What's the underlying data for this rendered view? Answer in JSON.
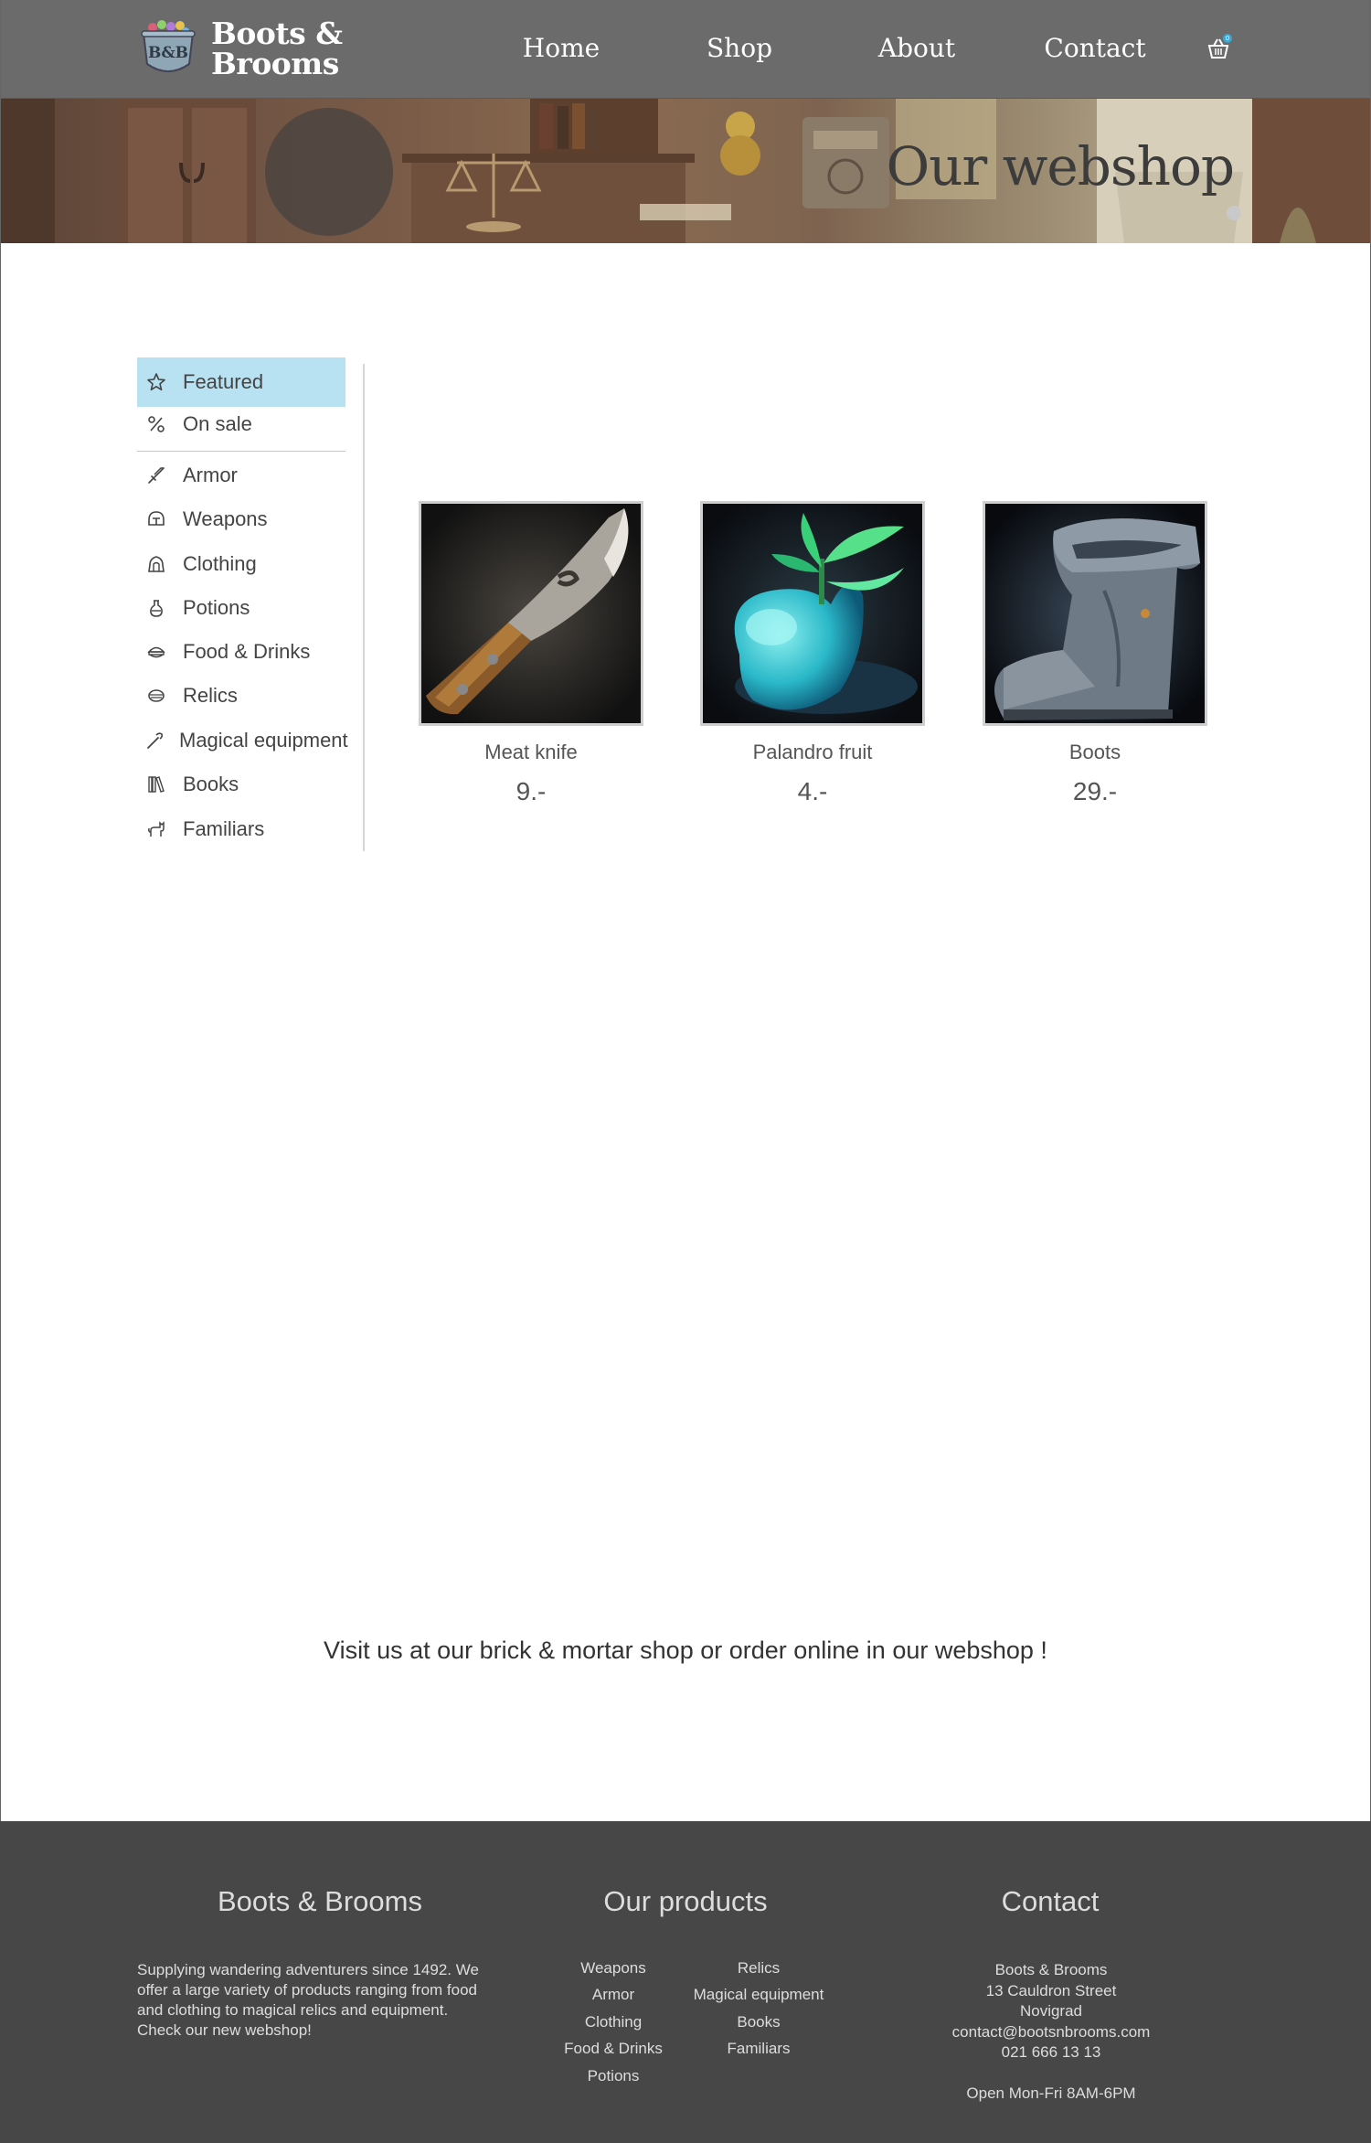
{
  "brand": {
    "badge_text": "B&B",
    "name_line1": "Boots &",
    "name_line2": "Brooms"
  },
  "nav": {
    "items": [
      {
        "label": "Home"
      },
      {
        "label": "Shop"
      },
      {
        "label": "About"
      },
      {
        "label": "Contact"
      }
    ],
    "cart_icon": "basket-icon",
    "cart_count": "0"
  },
  "hero": {
    "title": "Our webshop"
  },
  "sidebar": {
    "items": [
      {
        "label": "Featured",
        "icon": "star-icon",
        "active": true
      },
      {
        "label": "On sale",
        "icon": "percent-icon"
      },
      {
        "label": "Armor",
        "icon": "sword-icon"
      },
      {
        "label": "Weapons",
        "icon": "helmet-icon"
      },
      {
        "label": "Clothing",
        "icon": "cloak-icon"
      },
      {
        "label": "Potions",
        "icon": "potion-icon"
      },
      {
        "label": "Food & Drinks",
        "icon": "food-icon"
      },
      {
        "label": "Relics",
        "icon": "relic-icon"
      },
      {
        "label": "Magical equipment",
        "icon": "wand-icon"
      },
      {
        "label": "Books",
        "icon": "books-icon"
      },
      {
        "label": "Familiars",
        "icon": "cat-icon"
      }
    ],
    "active_color": "#b8e2f2"
  },
  "products": [
    {
      "name": "Meat knife",
      "price": "9.-",
      "icon": "knife-image"
    },
    {
      "name": "Palandro fruit",
      "price": "4.-",
      "icon": "fruit-image"
    },
    {
      "name": "Boots",
      "price": "29.-",
      "icon": "boot-image"
    }
  ],
  "tagline": "Visit us at our brick & mortar shop or order online in our webshop !",
  "footer": {
    "about": {
      "title": "Boots & Brooms",
      "text": "Supplying wandering adventurers since 1492. We offer a large variety of products ranging from food and clothing to magical relics and equipment. Check our new webshop!"
    },
    "products": {
      "title": "Our products",
      "col1": [
        "Weapons",
        "Armor",
        "Clothing",
        "Food & Drinks",
        "Potions"
      ],
      "col2": [
        "Relics",
        "Magical equipment",
        "Books",
        "Familiars"
      ]
    },
    "contact": {
      "title": "Contact",
      "name": "Boots & Brooms",
      "street": "13 Cauldron Street",
      "city": "Novigrad",
      "email": "contact@bootsnbrooms.com",
      "phone": "021 666 13 13",
      "hours": "Open Mon-Fri 8AM-6PM"
    }
  },
  "colors": {
    "navbar": "#6b6b6b",
    "footer": "#474747",
    "accent": "#3aa7d8"
  }
}
